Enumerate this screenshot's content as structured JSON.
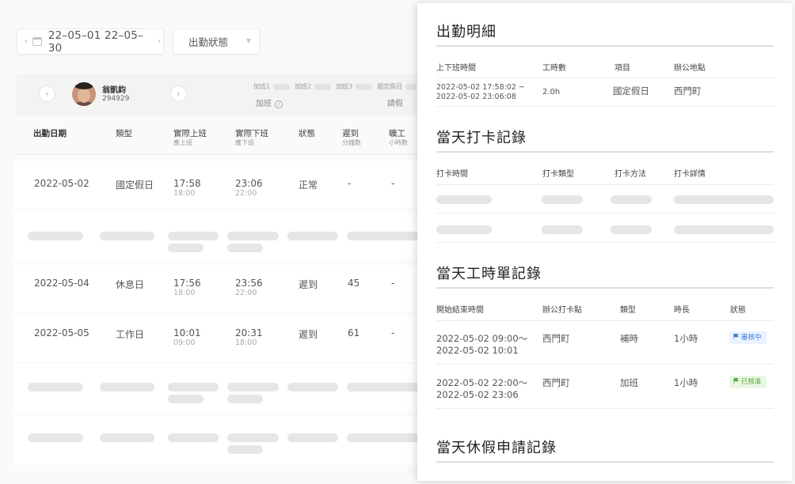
{
  "filters": {
    "date_range": "22–05–01 22–05–30",
    "status_label": "出勤狀態"
  },
  "employee": {
    "name": "翁凱鈞",
    "id": "294929"
  },
  "summary_labels": {
    "ot1": "加班1",
    "ot2": "加班2",
    "ot3": "加班3",
    "holiday": "國定假日",
    "overtime": "加班",
    "leave": "請假"
  },
  "table": {
    "headers": {
      "date": "出勤日期",
      "type": "類型",
      "clock_in": "實際上班",
      "clock_in_sub": "應上班",
      "clock_out": "實際下班",
      "clock_out_sub": "應下班",
      "status": "狀態",
      "late": "遲到",
      "late_sub": "分鐘數",
      "absent": "曠工",
      "absent_sub": "小時數"
    },
    "rows": [
      {
        "date": "2022-05-02",
        "type": "國定假日",
        "in": "17:58",
        "in_sched": "18:00",
        "out": "23:06",
        "out_sched": "22:00",
        "status": "正常",
        "late": "-",
        "absent": "-"
      },
      {
        "date": "2022-05-04",
        "type": "休息日",
        "in": "17:56",
        "in_sched": "18:00",
        "out": "23:56",
        "out_sched": "22:00",
        "status": "遲到",
        "late": "45",
        "absent": "-"
      },
      {
        "date": "2022-05-05",
        "type": "工作日",
        "in": "10:01",
        "in_sched": "09:00",
        "out": "20:31",
        "out_sched": "18:00",
        "status": "遲到",
        "late": "61",
        "absent": "-"
      }
    ]
  },
  "panel": {
    "detail": {
      "title": "出勤明細",
      "headers": [
        "上下班時間",
        "工時數",
        "項目",
        "辦公地點"
      ],
      "row": {
        "time_start": "2022-05-02 17:58:02 ~",
        "time_end": "2022-05-02 23:06:08",
        "hours": "2.0h",
        "item": "國定假日",
        "location": "西門町"
      }
    },
    "punch": {
      "title": "當天打卡記錄",
      "headers": [
        "打卡時間",
        "打卡類型",
        "打卡方法",
        "打卡詳情"
      ]
    },
    "timesheet": {
      "title": "當天工時單記錄",
      "headers": [
        "開始結束時間",
        "辦公打卡點",
        "類型",
        "時長",
        "狀態"
      ],
      "rows": [
        {
          "start": "2022-05-02 09:00～",
          "end": "2022-05-02 10:01",
          "location": "西門町",
          "type": "補時",
          "duration": "1小時",
          "status": "審核中"
        },
        {
          "start": "2022-05-02 22:00～",
          "end": "2022-05-02 23:06",
          "location": "西門町",
          "type": "加班",
          "duration": "1小時",
          "status": "已核准"
        }
      ]
    },
    "leave": {
      "title": "當天休假申請記錄"
    }
  },
  "colors": {
    "pending_tag": "#3a7bd5",
    "approved_tag": "#53a83a"
  }
}
